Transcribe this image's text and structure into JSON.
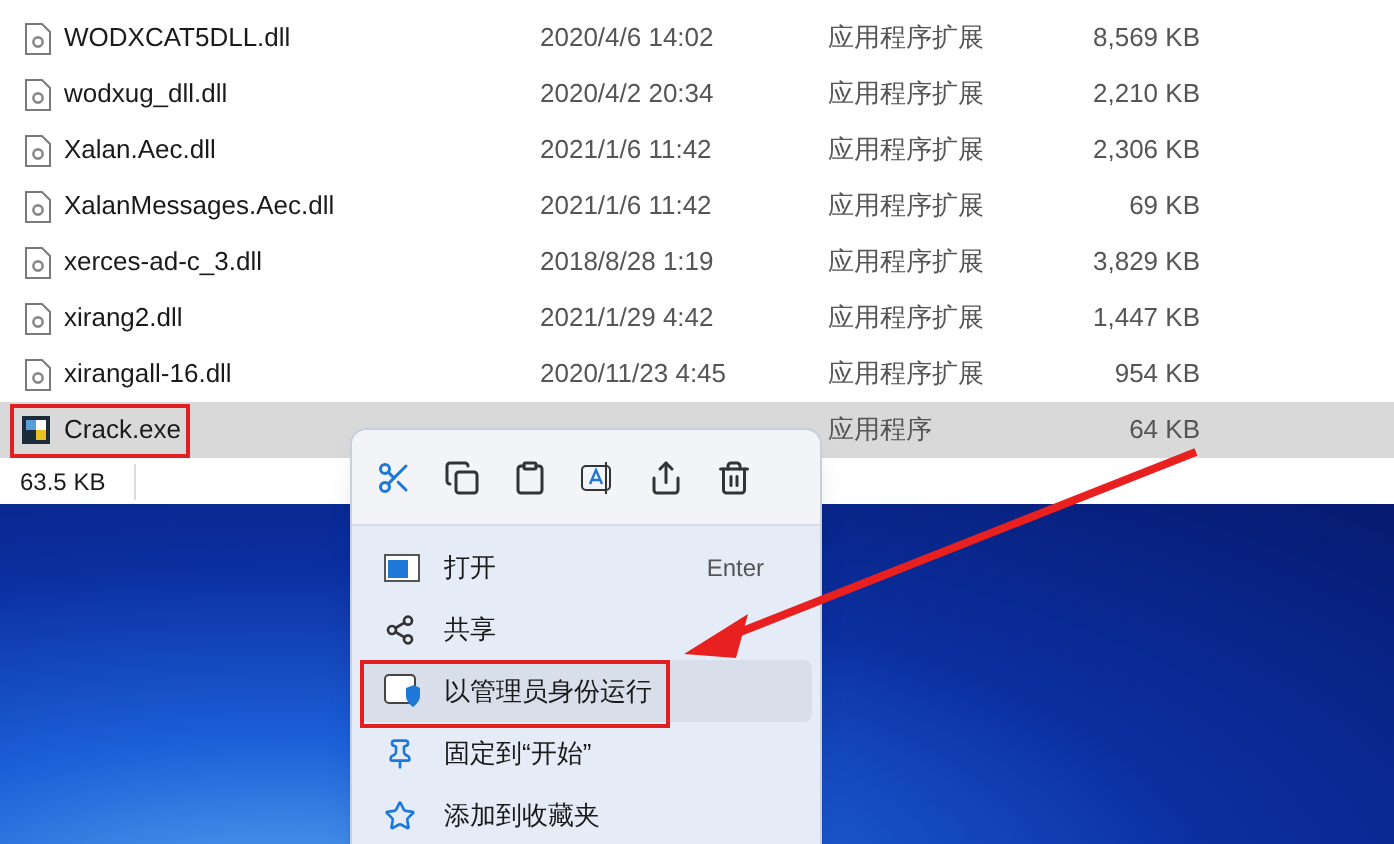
{
  "files": [
    {
      "name": "WODXCAT5DLL.dll",
      "kind": "dll",
      "date": "2020/4/6 14:02",
      "type": "应用程序扩展",
      "size": "8,569 KB",
      "selected": false
    },
    {
      "name": "wodxug_dll.dll",
      "kind": "dll",
      "date": "2020/4/2 20:34",
      "type": "应用程序扩展",
      "size": "2,210 KB",
      "selected": false
    },
    {
      "name": "Xalan.Aec.dll",
      "kind": "dll",
      "date": "2021/1/6 11:42",
      "type": "应用程序扩展",
      "size": "2,306 KB",
      "selected": false
    },
    {
      "name": "XalanMessages.Aec.dll",
      "kind": "dll",
      "date": "2021/1/6 11:42",
      "type": "应用程序扩展",
      "size": "69 KB",
      "selected": false
    },
    {
      "name": "xerces-ad-c_3.dll",
      "kind": "dll",
      "date": "2018/8/28 1:19",
      "type": "应用程序扩展",
      "size": "3,829 KB",
      "selected": false
    },
    {
      "name": "xirang2.dll",
      "kind": "dll",
      "date": "2021/1/29 4:42",
      "type": "应用程序扩展",
      "size": "1,447 KB",
      "selected": false
    },
    {
      "name": "xirangall-16.dll",
      "kind": "dll",
      "date": "2020/11/23 4:45",
      "type": "应用程序扩展",
      "size": "954 KB",
      "selected": false
    },
    {
      "name": "Crack.exe",
      "kind": "exe",
      "type": "应用程序",
      "size": "64 KB",
      "selected": true
    }
  ],
  "status_bar": {
    "selection_size": "63.5 KB"
  },
  "context_menu": {
    "items": [
      {
        "kind": "open",
        "label": "打开",
        "shortcut": "Enter",
        "highlighted": false
      },
      {
        "kind": "share",
        "label": "共享",
        "highlighted": false
      },
      {
        "kind": "admin",
        "label": "以管理员身份运行",
        "highlighted": true
      },
      {
        "kind": "pin",
        "label": "固定到“开始”",
        "highlighted": false
      },
      {
        "kind": "star",
        "label": "添加到收藏夹",
        "highlighted": false
      }
    ]
  }
}
